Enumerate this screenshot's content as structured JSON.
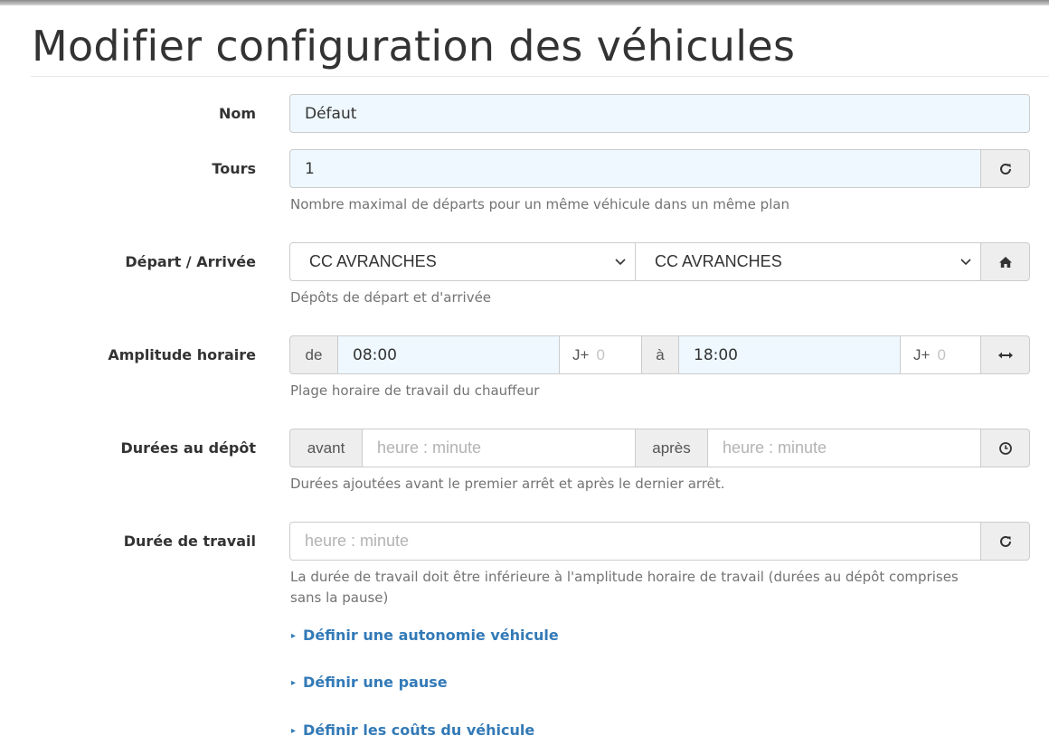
{
  "page": {
    "title": "Modifier configuration des véhicules"
  },
  "fields": {
    "nom": {
      "label": "Nom",
      "value": "Défaut"
    },
    "tours": {
      "label": "Tours",
      "value": "1",
      "help": "Nombre maximal de départs pour un même véhicule dans un même plan",
      "icon": "refresh-icon"
    },
    "depart_arrivee": {
      "label": "Départ / Arrivée",
      "departure": "CC AVRANCHES",
      "arrival": "CC AVRANCHES",
      "help": "Dépôts de départ et d'arrivée",
      "icon": "home-icon"
    },
    "amplitude": {
      "label": "Amplitude horaire",
      "from_prefix": "de",
      "from_time": "08:00",
      "from_day_prefix": "J+",
      "from_day": "0",
      "to_prefix": "à",
      "to_time": "18:00",
      "to_day_prefix": "J+",
      "to_day": "0",
      "help": "Plage horaire de travail du chauffeur",
      "icon": "swap-horizontal-icon"
    },
    "durees_depot": {
      "label": "Durées au dépôt",
      "before_prefix": "avant",
      "before_placeholder": "heure : minute",
      "after_prefix": "après",
      "after_placeholder": "heure : minute",
      "help": "Durées ajoutées avant le premier arrêt et après le dernier arrêt.",
      "icon": "clock-icon"
    },
    "duree_travail": {
      "label": "Durée de travail",
      "placeholder": "heure : minute",
      "help_line1": "La durée de travail doit être inférieure à l'amplitude horaire de travail (durées au dépôt comprises",
      "help_line2": "sans la pause)",
      "icon": "refresh-icon"
    }
  },
  "links": [
    {
      "label": "Définir une autonomie véhicule",
      "caret": "▸"
    },
    {
      "label": "Définir une pause",
      "caret": "▸"
    },
    {
      "label": "Définir les coûts du véhicule",
      "caret": "▸"
    }
  ]
}
